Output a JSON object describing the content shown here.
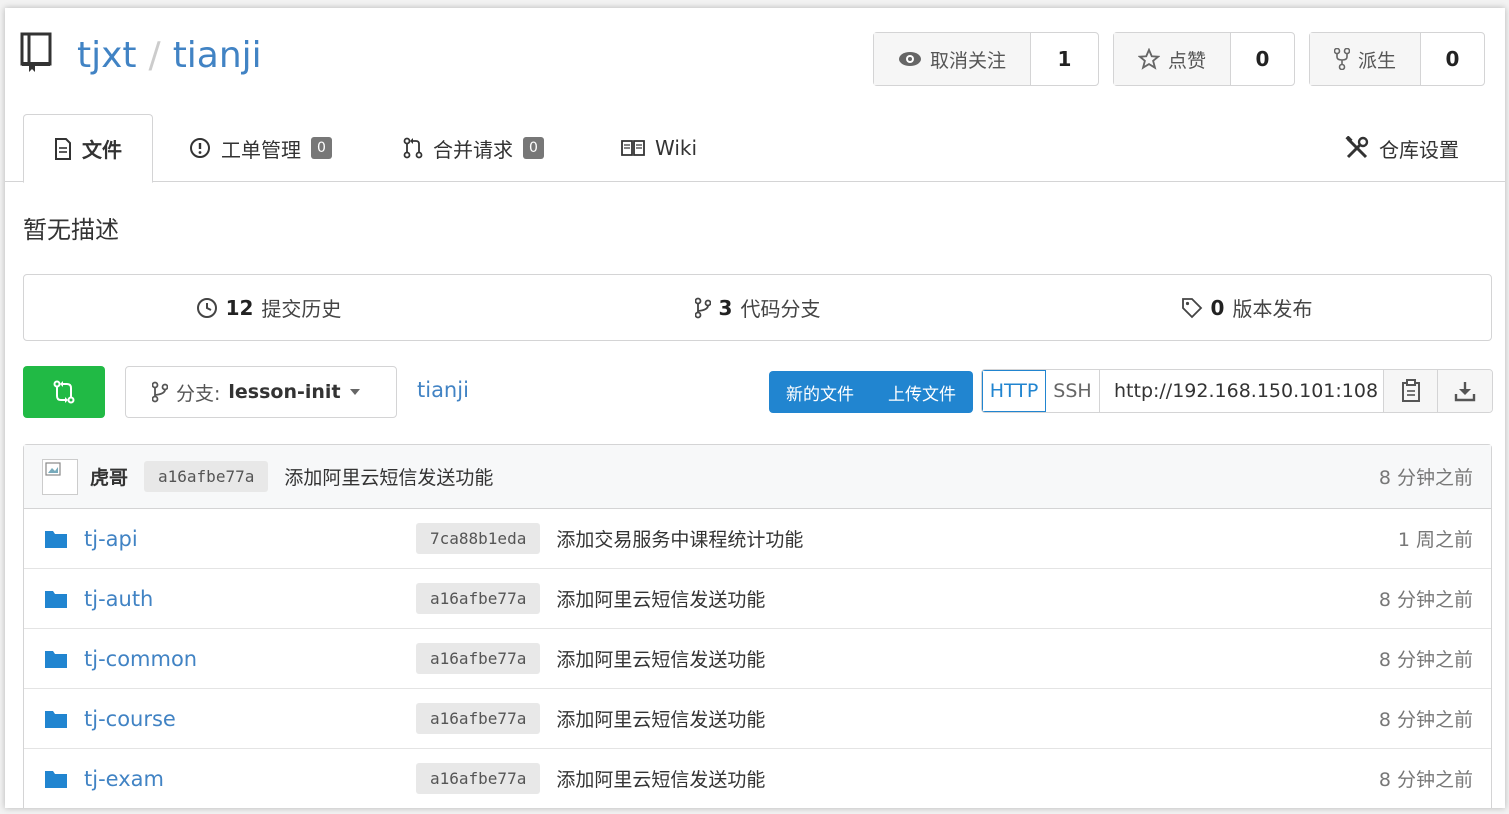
{
  "repo": {
    "owner": "tjxt",
    "separator": "/",
    "name": "tianji"
  },
  "actions": {
    "watch": {
      "label": "取消关注",
      "count": "1"
    },
    "star": {
      "label": "点赞",
      "count": "0"
    },
    "fork": {
      "label": "派生",
      "count": "0"
    }
  },
  "tabs": {
    "files": {
      "label": "文件"
    },
    "issues": {
      "label": "工单管理",
      "badge": "0"
    },
    "pulls": {
      "label": "合并请求",
      "badge": "0"
    },
    "wiki": {
      "label": "Wiki"
    },
    "settings": {
      "label": "仓库设置"
    }
  },
  "description": "暂无描述",
  "stats": {
    "commits": {
      "count": "12",
      "label": "提交历史"
    },
    "branches": {
      "count": "3",
      "label": "代码分支"
    },
    "releases": {
      "count": "0",
      "label": "版本发布"
    }
  },
  "toolbar": {
    "branch_prefix": "分支:",
    "branch": "lesson-init",
    "breadcrumb": "tianji",
    "new_file": "新的文件",
    "upload_file": "上传文件",
    "http": "HTTP",
    "ssh": "SSH",
    "clone_url": "http://192.168.150.101:108"
  },
  "latest_commit": {
    "author": "虎哥",
    "sha": "a16afbe77a",
    "message": "添加阿里云短信发送功能",
    "age": "8 分钟之前"
  },
  "files": [
    {
      "name": "tj-api",
      "sha": "7ca88b1eda",
      "message": "添加交易服务中课程统计功能",
      "age": "1 周之前"
    },
    {
      "name": "tj-auth",
      "sha": "a16afbe77a",
      "message": "添加阿里云短信发送功能",
      "age": "8 分钟之前"
    },
    {
      "name": "tj-common",
      "sha": "a16afbe77a",
      "message": "添加阿里云短信发送功能",
      "age": "8 分钟之前"
    },
    {
      "name": "tj-course",
      "sha": "a16afbe77a",
      "message": "添加阿里云短信发送功能",
      "age": "8 分钟之前"
    },
    {
      "name": "tj-exam",
      "sha": "a16afbe77a",
      "message": "添加阿里云短信发送功能",
      "age": "8 分钟之前"
    }
  ],
  "colors": {
    "link": "#4183c4",
    "green": "#21ba45",
    "blue": "#2185d0"
  }
}
